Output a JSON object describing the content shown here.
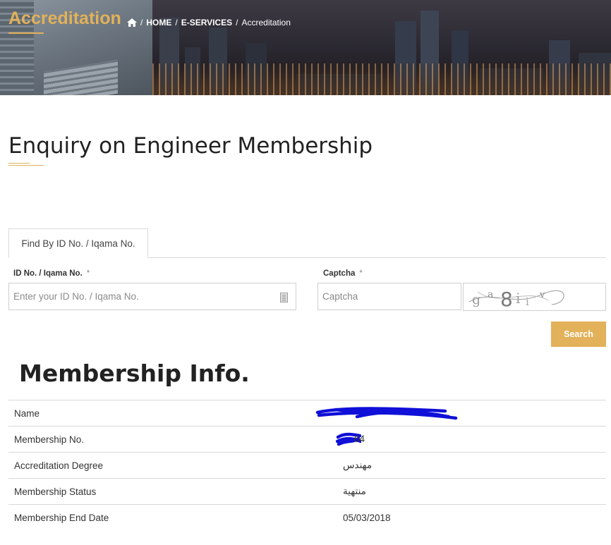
{
  "banner": {
    "title": "Accreditation",
    "breadcrumb": {
      "home_icon": "home-icon",
      "items": [
        "HOME",
        "E-SERVICES",
        "Accreditation"
      ],
      "separator": "/"
    }
  },
  "page": {
    "title": "Enquiry on Engineer Membership"
  },
  "tabs": [
    {
      "label": "Find By ID No. / Iqama No.",
      "active": true
    }
  ],
  "form": {
    "id_label": "ID No. / Iqama No.",
    "id_placeholder": "Enter your ID No. / Iqama No.",
    "id_value": "",
    "id_icon": "id-card-icon",
    "captcha_label": "Captcha",
    "captcha_placeholder": "Captcha",
    "captcha_value": "",
    "required_marker": "*",
    "captcha_text": "ga8iiv",
    "search_label": "Search"
  },
  "membership": {
    "title": "Membership Info.",
    "rows": [
      {
        "label": "Name",
        "value": "",
        "redacted": true
      },
      {
        "label": "Membership No.",
        "value": "64",
        "redacted": true
      },
      {
        "label": "Accreditation Degree",
        "value": "مهندس"
      },
      {
        "label": "Membership Status",
        "value": "منتهية"
      },
      {
        "label": "Membership End Date",
        "value": "05/03/2018"
      }
    ]
  },
  "colors": {
    "accent": "#e2b15a",
    "redaction": "#1010d8",
    "border": "#d9d9d9"
  }
}
